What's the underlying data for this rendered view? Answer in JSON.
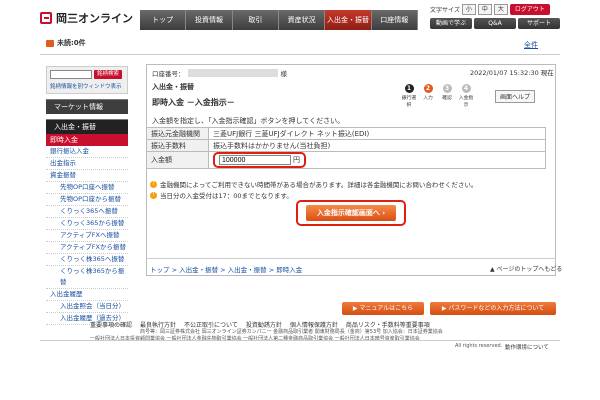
{
  "app": {
    "logo": "岡三オンライン"
  },
  "nav": [
    "トップ",
    "投資情報",
    "取引",
    "資産状況",
    "入出金・振替",
    "口座情報"
  ],
  "tools": {
    "fontsize_label": "文字サイズ",
    "sizes": [
      "小",
      "中",
      "大"
    ],
    "login_label": "ログアウト",
    "learn": "動画で学ぶ",
    "qa": "Q&A",
    "support": "サポート"
  },
  "notice": {
    "unread": "未読:0件",
    "close": "全件"
  },
  "sidebar": {
    "search_btn": "銘柄検索",
    "search_link": "銘柄情報を別ウィンドウ表示",
    "market": "マーケット情報",
    "section": "入出金・振替",
    "active": "即時入金",
    "items": [
      "銀行振込入金",
      "出金指示"
    ],
    "transfer": "資金振替",
    "transfer_items": [
      "先物OP口座へ振替",
      "先物OP口座から振替",
      "くりっく365へ振替",
      "くりっく365から振替",
      "アクティブFXへ振替",
      "アクティブFXから振替",
      "くりっく株365へ振替",
      "くりっく株365から振替"
    ],
    "history": "入出金履歴",
    "history_items": [
      "入出金照会（当日分）",
      "入出金履歴（過去分）"
    ]
  },
  "main": {
    "account_label": "口座番号：",
    "account_suffix": "様",
    "timestamp": "2022/01/07 15:32:30 現在",
    "breadcrumb": "入出金・振替",
    "title": "即時入金 －入金指示－",
    "steps": [
      {
        "n": "1",
        "label": "銀行選択"
      },
      {
        "n": "2",
        "label": "入力"
      },
      {
        "n": "3",
        "label": "確認"
      },
      {
        "n": "4",
        "label": "入金指示"
      }
    ],
    "help": "画面ヘルプ",
    "instruction": "入金額を指定し、「入金指示確認」ボタンを押してください。",
    "rows": [
      {
        "label": "振込元金融機関",
        "value": "三菱UFJ銀行 三菱UFJダイレクト ネット振込(EDI)"
      },
      {
        "label": "振込手数料",
        "value": "振込手数料はかかりません(当社負担)"
      }
    ],
    "amount_label": "入金額",
    "amount_value": "100000",
    "amount_unit": "円",
    "notes": [
      "金融機関によってご利用できない時間帯がある場合があります。詳細は各金融機関にお問い合わせください。",
      "当日分の入金受付は17：00までとなります。"
    ],
    "submit": "入金指示確認画面へ",
    "breadcrumb_bottom": "トップ > 入出金・振替 > 入出金・振替 > 即時入金",
    "page_top": "ページのトップへもどる"
  },
  "footer": {
    "manual": "マニュアルはこちら",
    "password": "パスワードなどの入力方法について",
    "links": [
      "重要事項の確認",
      "最良執行方針",
      "不公正取引について",
      "投資勧誘方針",
      "個人情報保護方針",
      "商品リスク・手数料等重要事項"
    ],
    "line1": "商号等：岡三証券株式会社 岡三オンライン証券カンパニー 金融商品取引業者 関東財務局長（金商）第53号 加入協会：日本証券業協会",
    "line2": "一般社団法人日本投資顧問業協会 一般社団法人金融先物取引業協会 一般社団法人第二種金融商品取引業協会 一般社団法人日本暗号資産取引業協会",
    "copyright": "All rights reserved.",
    "support_link": "動作環境について"
  }
}
